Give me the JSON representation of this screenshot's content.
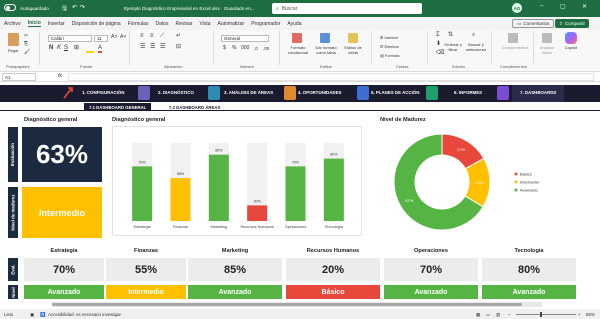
{
  "titlebar": {
    "autosave_label": "Autoguardado",
    "doc_title": "Ejemplo Diagnóstico Empresarial en Excel.xlsx  ·  Guardado en...",
    "search_placeholder": "Buscar",
    "user_initials": "AG"
  },
  "menu": {
    "tabs": [
      "Archivo",
      "Inicio",
      "Insertar",
      "Disposición de página",
      "Fórmulas",
      "Datos",
      "Revisar",
      "Vista",
      "Automatizar",
      "Programador",
      "Ayuda"
    ],
    "comments_label": "Comentarios",
    "share_label": "Compartir"
  },
  "ribbon": {
    "paste_label": "Pegar",
    "clipboard_group": "Portapapeles",
    "font_name": "Calibri",
    "font_size": "11",
    "font_group": "Fuente",
    "align_group": "Alineación",
    "number_format": "General",
    "number_group": "Número",
    "cond_format_label": "Formato condicional",
    "format_table_label": "Dar formato como tabla",
    "cell_styles_label": "Estilos de celda",
    "styles_group": "Estilos",
    "insert_label": "Insertar",
    "delete_label": "Eliminar",
    "format_label": "Formato",
    "cells_group": "Celdas",
    "sort_label": "Ordenar y filtrar",
    "find_label": "Buscar y seleccionar",
    "edit_group": "Edición",
    "addins_label": "Complementos",
    "addins_group": "Complementos",
    "analyze_label": "Analizar datos",
    "copilot_label": "Copilot"
  },
  "formula": {
    "name_box": "A1",
    "fx": "fx"
  },
  "nav": {
    "items": [
      "1. CONFIGURACIÓN",
      "2. DIAGNÓSTICO",
      "3. ANÁLISIS DE ÁREAS",
      "4. OPORTUNIDADES",
      "5. PLANES DE ACCIÓN",
      "6. INFORMES",
      "7. DASHBOARDS"
    ],
    "subtabs": [
      "7.1 DASHBOARD GENERAL",
      "7.2 DASHBOARD ÁREAS"
    ]
  },
  "left": {
    "title": "Diagnóstico general",
    "eval_label": "Evaluación",
    "score": "63%",
    "level_label": "Nivel de madurez",
    "level": "Intermedio"
  },
  "chart_data": [
    {
      "type": "bar",
      "title": "Diagnóstico general",
      "categories": [
        "Estrategia",
        "Finanzas",
        "Marketing",
        "Recursos Humanos",
        "Operaciones",
        "Tecnología"
      ],
      "values": [
        70,
        55,
        85,
        20,
        70,
        80
      ],
      "value_labels": [
        "70%",
        "55%",
        "85%",
        "20%",
        "70%",
        "80%"
      ],
      "ylim": [
        0,
        100
      ],
      "colors": [
        "#55b443",
        "#ffc000",
        "#55b443",
        "#e8483b",
        "#55b443",
        "#55b443"
      ]
    },
    {
      "type": "pie",
      "title": "Nivel de Madurez",
      "donut": true,
      "categories": [
        "Básico",
        "Intermedio",
        "Avanzado"
      ],
      "values": [
        17,
        17,
        67
      ],
      "value_labels": [
        "17%",
        "17%",
        "67%"
      ],
      "colors": [
        "#e8483b",
        "#ffc000",
        "#55b443"
      ],
      "legend": "right"
    }
  ],
  "kpis": [
    {
      "name": "Estrategia",
      "value": "70%",
      "level": "Avanzado",
      "color": "#55b443"
    },
    {
      "name": "Finanzas",
      "value": "55%",
      "level": "Intermedio",
      "color": "#ffc000"
    },
    {
      "name": "Marketing",
      "value": "85%",
      "level": "Avanzado",
      "color": "#55b443"
    },
    {
      "name": "Recursos Humanos",
      "value": "20%",
      "level": "Básico",
      "color": "#e8483b"
    },
    {
      "name": "Operaciones",
      "value": "70%",
      "level": "Avanzado",
      "color": "#55b443"
    },
    {
      "name": "Tecnología",
      "value": "80%",
      "level": "Avanzado",
      "color": "#55b443"
    }
  ],
  "kpi_row_labels": {
    "eval": "Eval.",
    "level": "Nivel"
  },
  "status": {
    "ready": "Listo",
    "accessibility": "Accesibilidad: es necesario investigar",
    "zoom": "85%"
  },
  "colors": {
    "excel_green": "#1e6e41",
    "navy": "#1b1b2f",
    "green": "#55b443",
    "amber": "#ffc000",
    "red": "#e8483b"
  }
}
